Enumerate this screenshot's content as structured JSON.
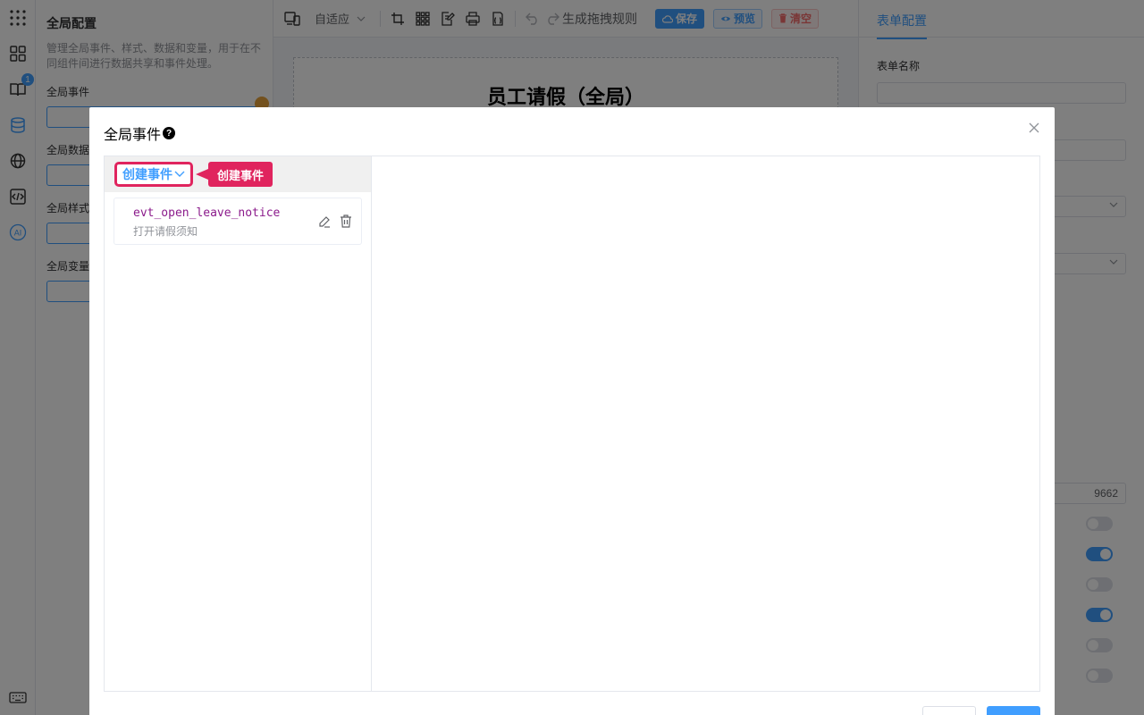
{
  "left_rail": {
    "items": [
      {
        "icon": "apps-grid-icon"
      },
      {
        "icon": "components-icon"
      },
      {
        "icon": "book-icon",
        "badge": "1"
      },
      {
        "icon": "database-icon"
      },
      {
        "icon": "globe-icon"
      },
      {
        "icon": "code-icon"
      },
      {
        "icon": "ai-icon",
        "label": "AI"
      }
    ],
    "bottom_icon": "keyboard-icon"
  },
  "global_panel": {
    "title": "全局配置",
    "description": "管理全局事件、样式、数据和变量，用于在不同组件间进行数据共享和事件处理。",
    "sections": [
      "全局事件",
      "全局数据",
      "全局样式",
      "全局变量"
    ]
  },
  "toolbar": {
    "layout_select": "自适应",
    "generate_rules": "生成拖拽规则",
    "save": "保存",
    "preview": "预览",
    "clear": "清空"
  },
  "canvas": {
    "form_title": "员工请假（全局）"
  },
  "right_panel": {
    "tab": "表单配置",
    "form_name_label": "表单名称",
    "form_name_value": "",
    "partial_value": "9662",
    "switches": [
      false,
      true,
      false,
      true,
      false,
      false
    ]
  },
  "dialog": {
    "title": "全局事件",
    "help_icon": "?",
    "create_button": "创建事件",
    "callout": "创建事件",
    "events": [
      {
        "name": "evt_open_leave_notice",
        "description": "打开请假须知"
      }
    ]
  }
}
